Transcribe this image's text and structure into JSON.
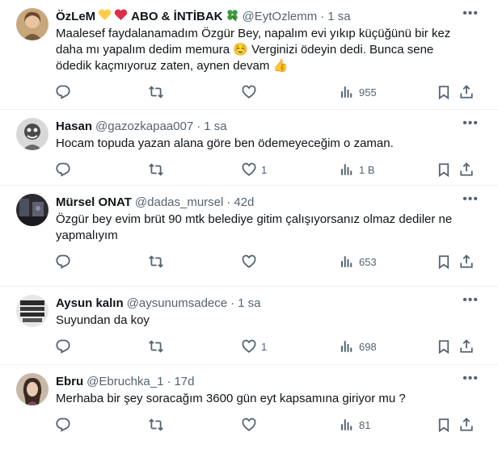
{
  "tweets": [
    {
      "name": "ÖzLeM",
      "name_suffix": "ABO & İNTİBAK",
      "handle": "@EytOzlemm",
      "time": "1 sa",
      "text": "Maalesef faydalanamadım Özgür Bey, napalım evi yıkıp küçüğünü bir kez daha mı yapalım dedim memura ☺️ Verginizi ödeyin dedi. Bunca sene ödedik kaçmıyoruz zaten, aynen devam 👍",
      "likes": "",
      "views": "955"
    },
    {
      "name": "Hasan",
      "handle": "@gazozkapaa007",
      "time": "1 sa",
      "text": "Hocam topuda yazan alana göre ben ödemeyeceğim o zaman.",
      "likes": "1",
      "views": "1 B"
    },
    {
      "name": "Mürsel ONAT",
      "handle": "@dadas_mursel",
      "time": "42d",
      "text": "Özgür bey  evim brüt 90 mtk belediye gitim çalışıyorsanız olmaz dediler ne yapmalıyım",
      "likes": "",
      "views": "653"
    },
    {
      "name": "Aysun kalın",
      "handle": "@aysunumsadece",
      "time": "1 sa",
      "text": "Suyundan da koy",
      "likes": "1",
      "views": "698"
    },
    {
      "name": "Ebru",
      "handle": "@Ebruchka_1",
      "time": "17d",
      "text": "Merhaba bir şey soracağım 3600 gün eyt kapsamına giriyor mu ?",
      "likes": "",
      "views": "81"
    }
  ],
  "icons": {
    "reply": "reply-icon",
    "retweet": "retweet-icon",
    "like": "like-icon",
    "views": "views-icon",
    "bookmark": "bookmark-icon",
    "share": "share-icon",
    "more": "more-icon"
  },
  "colors": {
    "text": "#0f1419",
    "secondary": "#536471",
    "divider": "#eff3f4"
  }
}
